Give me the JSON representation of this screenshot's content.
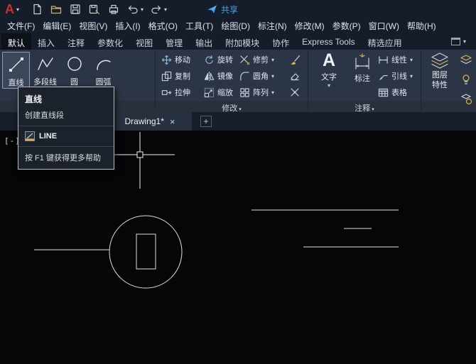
{
  "titlebar": {
    "logo_letter": "A",
    "share_label": "共享"
  },
  "menubar": {
    "items": [
      "文件(F)",
      "编辑(E)",
      "视图(V)",
      "插入(I)",
      "格式(O)",
      "工具(T)",
      "绘图(D)",
      "标注(N)",
      "修改(M)",
      "参数(P)",
      "窗口(W)",
      "帮助(H)"
    ]
  },
  "ribbon": {
    "tabs": [
      "默认",
      "插入",
      "注释",
      "参数化",
      "视图",
      "管理",
      "输出",
      "附加模块",
      "协作",
      "Express Tools",
      "精选应用"
    ],
    "panels": {
      "draw": {
        "tools": [
          "直线",
          "多段线",
          "圆",
          "圆弧"
        ]
      },
      "modify": {
        "label": "修改",
        "rows": [
          [
            "移动",
            "旋转",
            "修剪"
          ],
          [
            "复制",
            "镜像",
            "圆角"
          ],
          [
            "拉伸",
            "缩放",
            "阵列"
          ]
        ]
      },
      "annotate": {
        "label": "注释",
        "text_icon": "A",
        "text_tool": "文字",
        "dim_tool": "标注",
        "small_tools": [
          "线性",
          "引线",
          "表格"
        ]
      },
      "layers": {
        "button_label_line1": "图层",
        "button_label_line2": "特性"
      }
    }
  },
  "doc_tabs": {
    "active": "Drawing1*"
  },
  "tooltip": {
    "title": "直线",
    "description": "创建直线段",
    "command": "LINE",
    "help": "按 F1 键获得更多帮助"
  },
  "canvas": {
    "viewport_controls": "[-]["
  },
  "glyphs": {
    "dropdown": "▾",
    "close": "×",
    "plus": "+"
  }
}
